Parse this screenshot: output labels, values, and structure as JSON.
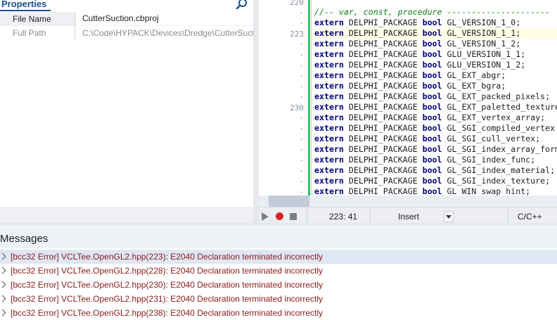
{
  "properties": {
    "title": "Properties",
    "rows": [
      {
        "name": "File Name",
        "value": "CutterSuction.cbproj"
      },
      {
        "name": "Full Path",
        "value": "C:\\Code\\HYPACK\\Devices\\Dredge\\CutterSuct"
      }
    ]
  },
  "editor": {
    "gutter": [
      {
        "label": "220"
      },
      {
        "label": "·"
      },
      {
        "label": "·"
      },
      {
        "label": "223"
      },
      {
        "label": "·"
      },
      {
        "label": "·"
      },
      {
        "label": "·"
      },
      {
        "label": "·"
      },
      {
        "label": "·"
      },
      {
        "label": "·"
      },
      {
        "label": "230"
      },
      {
        "label": "·"
      },
      {
        "label": "·"
      },
      {
        "label": "·"
      },
      {
        "label": "·"
      },
      {
        "label": "·"
      },
      {
        "label": "·"
      },
      {
        "label": "·"
      },
      {
        "label": "·"
      }
    ],
    "keyword_extern": "extern",
    "macro": "DELPHI_PACKAGE",
    "type_bool": "bool",
    "comment_line": "//-- var, const, procedure ---------------------",
    "lines": [
      "GL_VERSION_1_0;",
      "GL_VERSION_1_1;",
      "GL_VERSION_1_2;",
      "GLU_VERSION_1_1;",
      "GLU_VERSION_1_2;",
      "GL_EXT_abgr;",
      "GL_EXT_bgra;",
      "GL_EXT_packed_pixels;",
      "GL_EXT_paletted_texture",
      "GL_EXT_vertex_array;",
      "GL_SGI_compiled_vertex",
      "GL_SGI_cull_vertex;",
      "GL_SGI_index_array_form",
      "GL_SGI_index_func;",
      "GL_SGI_index_material;",
      "GL_SGI_index_texture;",
      "GL_WIN_swap_hint;"
    ]
  },
  "status": {
    "position": "223:  41",
    "mode": "Insert",
    "language": "C/C++"
  },
  "messages": {
    "title": "Messages",
    "items": [
      "[bcc32 Error] VCLTee.OpenGL2.hpp(223): E2040 Declaration terminated incorrectly",
      "[bcc32 Error] VCLTee.OpenGL2.hpp(228): E2040 Declaration terminated incorrectly",
      "[bcc32 Error] VCLTee.OpenGL2.hpp(230): E2040 Declaration terminated incorrectly",
      "[bcc32 Error] VCLTee.OpenGL2.hpp(231): E2040 Declaration terminated incorrectly",
      "[bcc32 Error] VCLTee.OpenGL2.hpp(238): E2040 Declaration terminated incorrectly"
    ]
  },
  "colors": {
    "accent": "#1b4f99",
    "keyword": "#00007f",
    "comment": "#0f7f12",
    "error_text": "#8b1a1a",
    "change_bar": "#2ec16b"
  }
}
